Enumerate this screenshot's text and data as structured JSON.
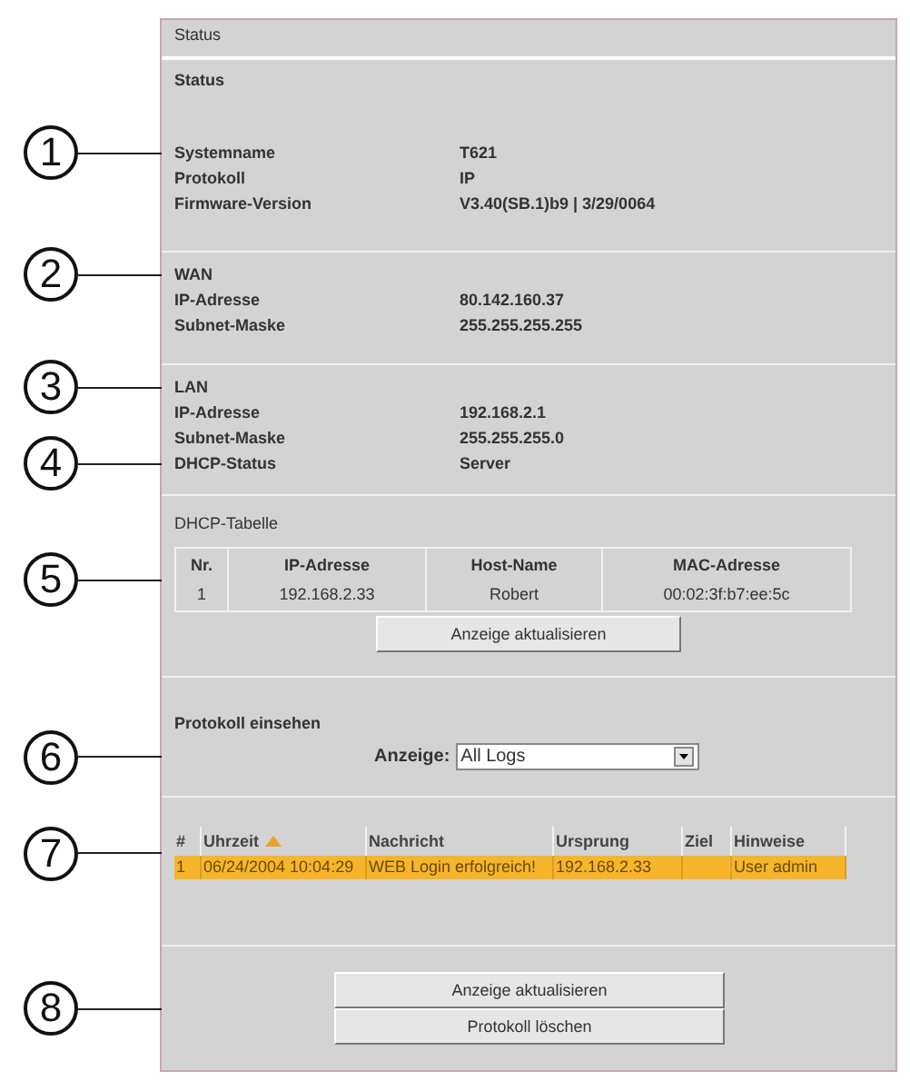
{
  "header": "Status",
  "title": "Status",
  "system": {
    "rows": [
      {
        "label": "Systemname",
        "value": "T621",
        "callout": "1"
      },
      {
        "label": "Protokoll",
        "value": "IP"
      },
      {
        "label": "Firmware-Version",
        "value": "V3.40(SB.1)b9 | 3/29/0064"
      }
    ]
  },
  "wan": {
    "heading": "WAN",
    "callout": "2",
    "rows": [
      {
        "label": "IP-Adresse",
        "value": "80.142.160.37"
      },
      {
        "label": "Subnet-Maske",
        "value": "255.255.255.255"
      }
    ]
  },
  "lan": {
    "heading": "LAN",
    "callout": "3",
    "rows": [
      {
        "label": "IP-Adresse",
        "value": "192.168.2.1"
      },
      {
        "label": "Subnet-Maske",
        "value": "255.255.255.0"
      },
      {
        "label": "DHCP-Status",
        "value": "Server",
        "callout": "4"
      }
    ]
  },
  "dhcp_table": {
    "heading": "DHCP-Tabelle",
    "callout": "5",
    "columns": [
      "Nr.",
      "IP-Adresse",
      "Host-Name",
      "MAC-Adresse"
    ],
    "rows": [
      [
        "1",
        "192.168.2.33",
        "Robert",
        "00:02:3f:b7:ee:5c"
      ]
    ],
    "button": "Anzeige aktualisieren"
  },
  "log_view": {
    "heading": "Protokoll einsehen",
    "callout": "6",
    "select_label": "Anzeige:",
    "select_value": "All Logs"
  },
  "log_table": {
    "callout": "7",
    "columns": [
      {
        "label": "#",
        "sorted": false
      },
      {
        "label": "Uhrzeit",
        "sorted": true
      },
      {
        "label": "Nachricht",
        "sorted": false
      },
      {
        "label": "Ursprung",
        "sorted": false
      },
      {
        "label": "Ziel",
        "sorted": false
      },
      {
        "label": "Hinweise",
        "sorted": false
      }
    ],
    "rows": [
      {
        "selected": true,
        "cells": [
          "1",
          "06/24/2004 10:04:29",
          "WEB Login erfolgreich!",
          "192.168.2.33",
          "",
          "User admin"
        ]
      }
    ]
  },
  "actions": {
    "callout": "8",
    "buttons": [
      "Anzeige aktualisieren",
      "Protokoll löschen"
    ]
  }
}
